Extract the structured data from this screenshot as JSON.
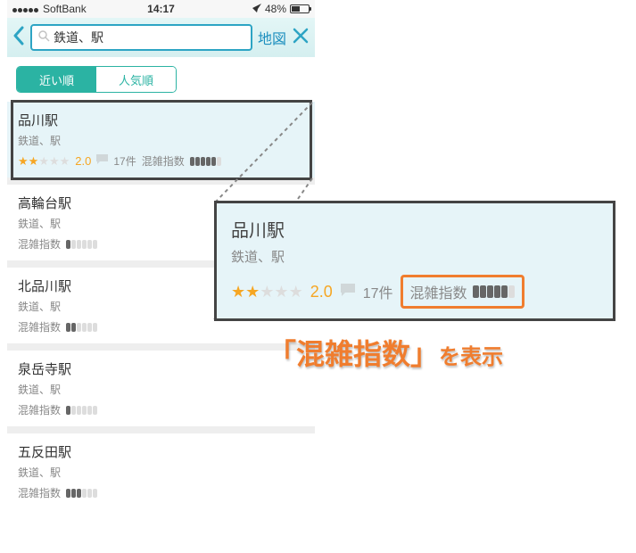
{
  "status": {
    "carrier": "SoftBank",
    "time": "14:17",
    "battery_pct": "48%"
  },
  "search": {
    "query": "鉄道、駅",
    "map_label": "地図"
  },
  "segment": {
    "near": "近い順",
    "popular": "人気順"
  },
  "crowd_label": "混雑指数",
  "results": [
    {
      "name": "品川駅",
      "category": "鉄道、駅",
      "rating": "2.0",
      "stars": 2,
      "reviews": "17件",
      "crowd": 5,
      "highlight": true
    },
    {
      "name": "高輪台駅",
      "category": "鉄道、駅",
      "crowd": 1
    },
    {
      "name": "北品川駅",
      "category": "鉄道、駅",
      "crowd": 2
    },
    {
      "name": "泉岳寺駅",
      "category": "鉄道、駅",
      "crowd": 1
    },
    {
      "name": "五反田駅",
      "category": "鉄道、駅",
      "crowd": 3
    }
  ],
  "zoom": {
    "name": "品川駅",
    "category": "鉄道、駅",
    "rating": "2.0",
    "stars": 2,
    "reviews": "17件",
    "crowd": 5
  },
  "annotation": {
    "strong": "「混雑指数」",
    "tail": "を表示"
  }
}
